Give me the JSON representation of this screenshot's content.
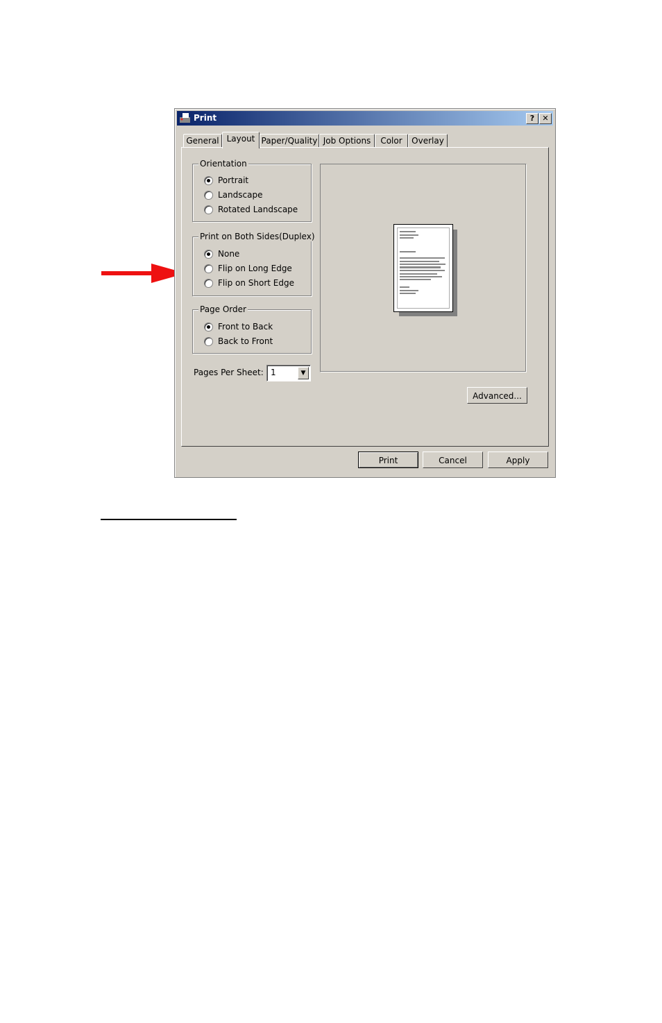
{
  "window": {
    "title": "Print",
    "help": "?",
    "close": "✕"
  },
  "tabs": [
    "General",
    "Layout",
    "Paper/Quality",
    "Job Options",
    "Color",
    "Overlay"
  ],
  "orientation": {
    "label": "Orientation",
    "options": [
      "Portrait",
      "Landscape",
      "Rotated Landscape"
    ],
    "selected": "Portrait"
  },
  "duplex": {
    "label": "Print on Both Sides(Duplex)",
    "options": [
      "None",
      "Flip on Long Edge",
      "Flip on Short Edge"
    ],
    "selected": "None"
  },
  "page_order": {
    "label": "Page Order",
    "options": [
      "Front to Back",
      "Back to Front"
    ],
    "selected": "Front to Back"
  },
  "pages_per_sheet": {
    "label": "Pages Per Sheet:",
    "value": "1"
  },
  "buttons": {
    "advanced": "Advanced...",
    "print": "Print",
    "cancel": "Cancel",
    "apply": "Apply"
  },
  "colors": {
    "arrow": "#ee1111",
    "titlebar_start": "#0a246a",
    "titlebar_end": "#a6caf0",
    "face": "#d4d0c8"
  }
}
